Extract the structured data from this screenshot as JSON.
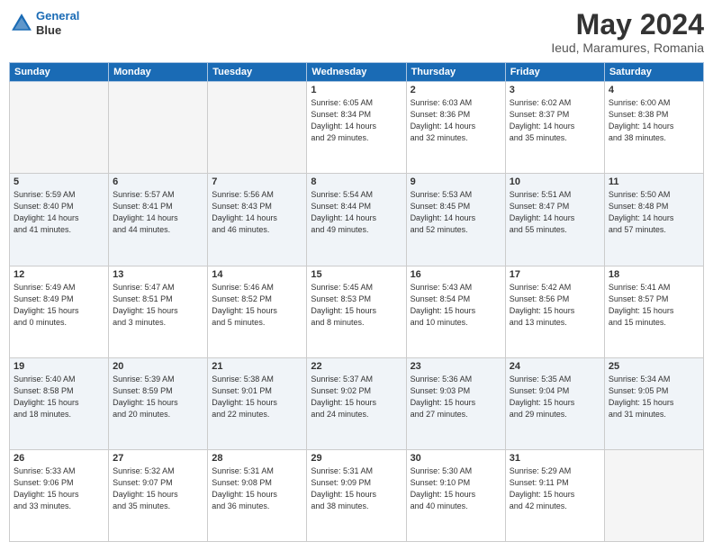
{
  "header": {
    "logo": {
      "line1": "General",
      "line2": "Blue"
    },
    "title": "May 2024",
    "location": "Ieud, Maramures, Romania"
  },
  "weekdays": [
    "Sunday",
    "Monday",
    "Tuesday",
    "Wednesday",
    "Thursday",
    "Friday",
    "Saturday"
  ],
  "weeks": [
    [
      {
        "day": "",
        "info": ""
      },
      {
        "day": "",
        "info": ""
      },
      {
        "day": "",
        "info": ""
      },
      {
        "day": "1",
        "info": "Sunrise: 6:05 AM\nSunset: 8:34 PM\nDaylight: 14 hours\nand 29 minutes."
      },
      {
        "day": "2",
        "info": "Sunrise: 6:03 AM\nSunset: 8:36 PM\nDaylight: 14 hours\nand 32 minutes."
      },
      {
        "day": "3",
        "info": "Sunrise: 6:02 AM\nSunset: 8:37 PM\nDaylight: 14 hours\nand 35 minutes."
      },
      {
        "day": "4",
        "info": "Sunrise: 6:00 AM\nSunset: 8:38 PM\nDaylight: 14 hours\nand 38 minutes."
      }
    ],
    [
      {
        "day": "5",
        "info": "Sunrise: 5:59 AM\nSunset: 8:40 PM\nDaylight: 14 hours\nand 41 minutes."
      },
      {
        "day": "6",
        "info": "Sunrise: 5:57 AM\nSunset: 8:41 PM\nDaylight: 14 hours\nand 44 minutes."
      },
      {
        "day": "7",
        "info": "Sunrise: 5:56 AM\nSunset: 8:43 PM\nDaylight: 14 hours\nand 46 minutes."
      },
      {
        "day": "8",
        "info": "Sunrise: 5:54 AM\nSunset: 8:44 PM\nDaylight: 14 hours\nand 49 minutes."
      },
      {
        "day": "9",
        "info": "Sunrise: 5:53 AM\nSunset: 8:45 PM\nDaylight: 14 hours\nand 52 minutes."
      },
      {
        "day": "10",
        "info": "Sunrise: 5:51 AM\nSunset: 8:47 PM\nDaylight: 14 hours\nand 55 minutes."
      },
      {
        "day": "11",
        "info": "Sunrise: 5:50 AM\nSunset: 8:48 PM\nDaylight: 14 hours\nand 57 minutes."
      }
    ],
    [
      {
        "day": "12",
        "info": "Sunrise: 5:49 AM\nSunset: 8:49 PM\nDaylight: 15 hours\nand 0 minutes."
      },
      {
        "day": "13",
        "info": "Sunrise: 5:47 AM\nSunset: 8:51 PM\nDaylight: 15 hours\nand 3 minutes."
      },
      {
        "day": "14",
        "info": "Sunrise: 5:46 AM\nSunset: 8:52 PM\nDaylight: 15 hours\nand 5 minutes."
      },
      {
        "day": "15",
        "info": "Sunrise: 5:45 AM\nSunset: 8:53 PM\nDaylight: 15 hours\nand 8 minutes."
      },
      {
        "day": "16",
        "info": "Sunrise: 5:43 AM\nSunset: 8:54 PM\nDaylight: 15 hours\nand 10 minutes."
      },
      {
        "day": "17",
        "info": "Sunrise: 5:42 AM\nSunset: 8:56 PM\nDaylight: 15 hours\nand 13 minutes."
      },
      {
        "day": "18",
        "info": "Sunrise: 5:41 AM\nSunset: 8:57 PM\nDaylight: 15 hours\nand 15 minutes."
      }
    ],
    [
      {
        "day": "19",
        "info": "Sunrise: 5:40 AM\nSunset: 8:58 PM\nDaylight: 15 hours\nand 18 minutes."
      },
      {
        "day": "20",
        "info": "Sunrise: 5:39 AM\nSunset: 8:59 PM\nDaylight: 15 hours\nand 20 minutes."
      },
      {
        "day": "21",
        "info": "Sunrise: 5:38 AM\nSunset: 9:01 PM\nDaylight: 15 hours\nand 22 minutes."
      },
      {
        "day": "22",
        "info": "Sunrise: 5:37 AM\nSunset: 9:02 PM\nDaylight: 15 hours\nand 24 minutes."
      },
      {
        "day": "23",
        "info": "Sunrise: 5:36 AM\nSunset: 9:03 PM\nDaylight: 15 hours\nand 27 minutes."
      },
      {
        "day": "24",
        "info": "Sunrise: 5:35 AM\nSunset: 9:04 PM\nDaylight: 15 hours\nand 29 minutes."
      },
      {
        "day": "25",
        "info": "Sunrise: 5:34 AM\nSunset: 9:05 PM\nDaylight: 15 hours\nand 31 minutes."
      }
    ],
    [
      {
        "day": "26",
        "info": "Sunrise: 5:33 AM\nSunset: 9:06 PM\nDaylight: 15 hours\nand 33 minutes."
      },
      {
        "day": "27",
        "info": "Sunrise: 5:32 AM\nSunset: 9:07 PM\nDaylight: 15 hours\nand 35 minutes."
      },
      {
        "day": "28",
        "info": "Sunrise: 5:31 AM\nSunset: 9:08 PM\nDaylight: 15 hours\nand 36 minutes."
      },
      {
        "day": "29",
        "info": "Sunrise: 5:31 AM\nSunset: 9:09 PM\nDaylight: 15 hours\nand 38 minutes."
      },
      {
        "day": "30",
        "info": "Sunrise: 5:30 AM\nSunset: 9:10 PM\nDaylight: 15 hours\nand 40 minutes."
      },
      {
        "day": "31",
        "info": "Sunrise: 5:29 AM\nSunset: 9:11 PM\nDaylight: 15 hours\nand 42 minutes."
      },
      {
        "day": "",
        "info": ""
      }
    ]
  ]
}
